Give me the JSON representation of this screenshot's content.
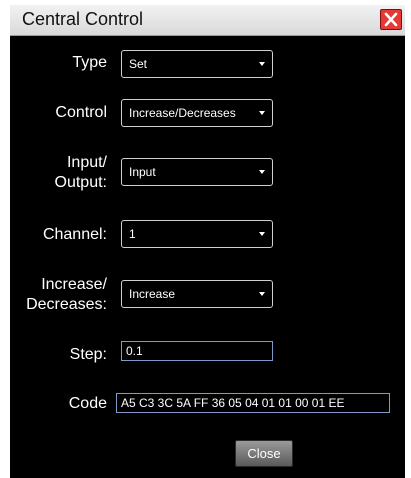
{
  "window": {
    "title": "Central Control"
  },
  "fields": {
    "type": {
      "label": "Type",
      "value": "Set"
    },
    "control": {
      "label": "Control",
      "value": "Increase/Decreases"
    },
    "input_output": {
      "label_line1": "Input/",
      "label_line2": "Output:",
      "value": "Input"
    },
    "channel": {
      "label": "Channel:",
      "value": "1"
    },
    "increase_decreases": {
      "label_line1": "Increase/",
      "label_line2": "Decreases:",
      "value": "Increase"
    },
    "step": {
      "label": "Step:",
      "value": "0.1"
    },
    "code": {
      "label": "Code",
      "value": "A5 C3 3C 5A FF 36 05 04 01 01 00 01 EE"
    }
  },
  "buttons": {
    "close_label": "Close"
  }
}
